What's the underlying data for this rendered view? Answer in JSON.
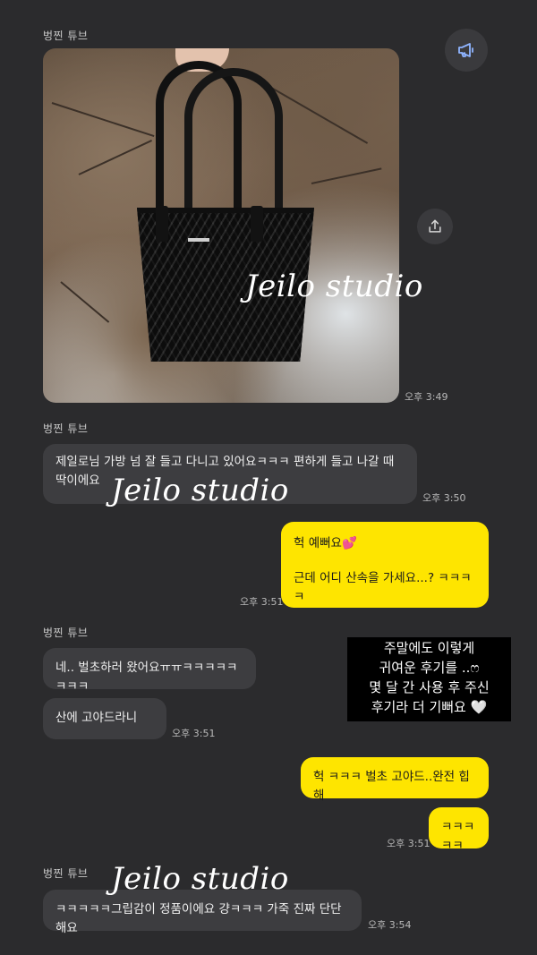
{
  "sender_name": "벙찐 튜브",
  "watermark_text": "Jeilo studio",
  "photo_message": {
    "time": "오후 3:49",
    "description": "bag photo"
  },
  "messages": [
    {
      "id": "m1",
      "direction": "in",
      "lines": [
        "제일로님 가방 넘 잘 들고 다니고 있어요ㅋㅋㅋ 편하게 들고 나갈 때",
        "딱이에요"
      ],
      "time": "오후 3:50"
    },
    {
      "id": "m2",
      "direction": "out",
      "lines": [
        "헉 예뻐요💕",
        "근데 어디 산속을 가세요...? ㅋㅋㅋㅋ"
      ],
      "time": "오후 3:51"
    },
    {
      "id": "m3",
      "direction": "in",
      "lines": [
        "네.. 벌초하러 왔어요ㅠㅠㅋㅋㅋㅋㅋㅋㅋㅋ"
      ]
    },
    {
      "id": "m4",
      "direction": "in",
      "lines": [
        "산에 고야드라니"
      ],
      "time": "오후 3:51"
    },
    {
      "id": "m5",
      "direction": "out",
      "lines": [
        "헉 ㅋㅋㅋ 벌초 고야드..완전 힙해"
      ]
    },
    {
      "id": "m6",
      "direction": "out",
      "lines": [
        "ㅋㅋㅋㅋㅋ"
      ],
      "time": "오후 3:51"
    },
    {
      "id": "m7",
      "direction": "in",
      "lines": [
        "ㅋㅋㅋㅋㅋ그립감이 정품이에요 걍ㅋㅋㅋ 가죽 진짜 단단해요"
      ],
      "time": "오후 3:54"
    }
  ],
  "caption_overlay": {
    "lines": [
      "주말에도 이렇게",
      "귀여운 후기를 ..ෆ",
      "몇 달 간 사용 후 주신",
      "후기라 더 기뻐요 🤍"
    ]
  },
  "icons": {
    "announce": "megaphone-icon",
    "share": "share-icon"
  },
  "colors": {
    "background": "#2b2b2d",
    "incoming_bubble": "#3d3d40",
    "outgoing_bubble": "#fee500",
    "announce_icon": "#8fb4ff"
  }
}
